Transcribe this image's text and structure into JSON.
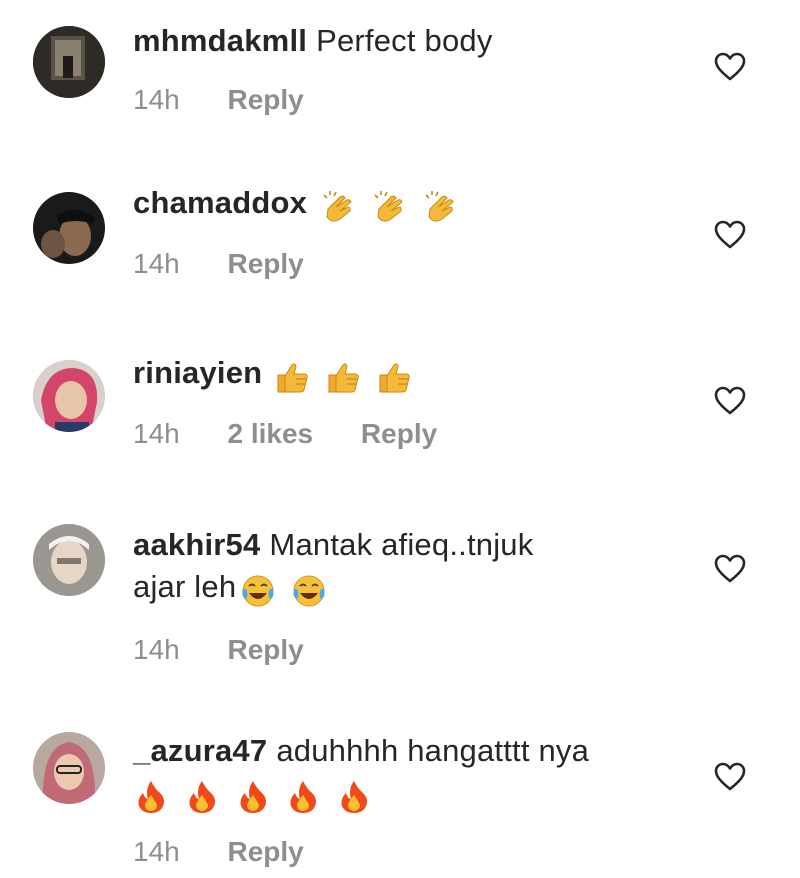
{
  "comments": [
    {
      "username": "mhmdakmll",
      "text": "Perfect body",
      "text2": "",
      "emojis": [],
      "time": "14h",
      "likes": "",
      "reply": "Reply"
    },
    {
      "username": "chamaddox",
      "text": "",
      "text2": "",
      "emojis": [
        "clapping-hands",
        "clapping-hands",
        "clapping-hands"
      ],
      "time": "14h",
      "likes": "",
      "reply": "Reply"
    },
    {
      "username": "riniayien",
      "text": "",
      "text2": "",
      "emojis": [
        "thumbs-up",
        "thumbs-up",
        "thumbs-up"
      ],
      "time": "14h",
      "likes": "2 likes",
      "reply": "Reply"
    },
    {
      "username": "aakhir54",
      "text": "Mantak afieq..tnjuk",
      "text2": "ajar leh",
      "emojis": [
        "tears-of-joy",
        "tears-of-joy"
      ],
      "time": "14h",
      "likes": "",
      "reply": "Reply"
    },
    {
      "username": "_azura47",
      "text": "aduhhhh hangatttt nya",
      "text2": "",
      "emojis": [
        "fire",
        "fire",
        "fire",
        "fire",
        "fire"
      ],
      "time": "14h",
      "likes": "",
      "reply": "Reply"
    }
  ],
  "colors": {
    "text": "#262626",
    "meta": "#8e8e8e",
    "heart_stroke": "#262626"
  },
  "icons": {
    "like": "heart-outline-icon"
  }
}
